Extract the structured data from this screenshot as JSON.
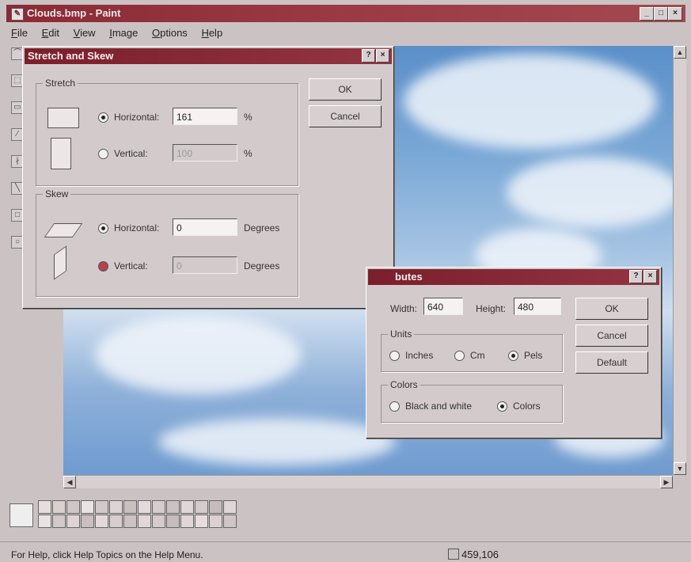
{
  "window": {
    "title": "Clouds.bmp - Paint",
    "controls": [
      "_",
      "□",
      "×"
    ]
  },
  "menu": [
    "File",
    "Edit",
    "View",
    "Image",
    "Options",
    "Help"
  ],
  "stretch_skew": {
    "title": "Stretch and Skew",
    "help": "?",
    "close": "×",
    "stretch_group": "Stretch",
    "stretch_h_label": "Horizontal:",
    "stretch_h_value": "161",
    "stretch_h_unit": "%",
    "stretch_v_label": "Vertical:",
    "stretch_v_value": "100",
    "stretch_v_unit": "%",
    "skew_group": "Skew",
    "skew_h_label": "Horizontal:",
    "skew_h_value": "0",
    "skew_h_unit": "Degrees",
    "skew_v_label": "Vertical:",
    "skew_v_value": "0",
    "skew_v_unit": "Degrees",
    "ok": "OK",
    "cancel": "Cancel"
  },
  "attributes": {
    "title": "butes",
    "help": "?",
    "close": "×",
    "width_label": "Width:",
    "width_value": "640",
    "height_label": "Height:",
    "height_value": "480",
    "units_group": "Units",
    "inches": "Inches",
    "cm": "Cm",
    "pels": "Pels",
    "colors_group": "Colors",
    "bw": "Black and white",
    "colors": "Colors",
    "ok": "OK",
    "cancel": "Cancel",
    "default": "Default"
  },
  "status": {
    "help_text": "For Help, click Help Topics on the Help Menu.",
    "coords": "459,106"
  },
  "colors": {
    "title_bar": "#8a2a35",
    "dialog_bg": "#d3cbcb",
    "sky": "#79a7d6"
  }
}
